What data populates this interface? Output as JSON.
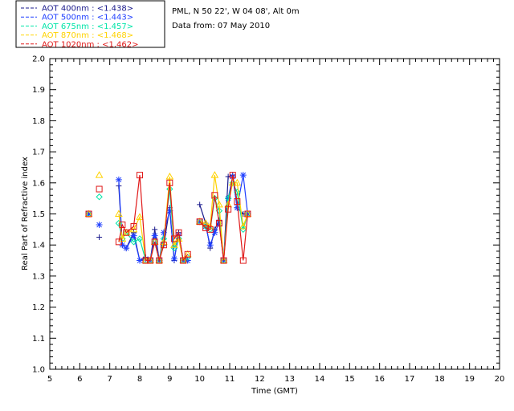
{
  "header": {
    "site": "PML, N 50 22', W 04 08', Alt 0m",
    "date": "Data from: 07 May 2010"
  },
  "chart_data": {
    "type": "line",
    "xlabel": "Time (GMT)",
    "ylabel": "Real Part of Refractive index",
    "xlim": [
      5,
      20
    ],
    "ylim": [
      1.0,
      2.0
    ],
    "xticks": [
      "5",
      "6",
      "7",
      "8",
      "9",
      "10",
      "11",
      "12",
      "13",
      "14",
      "15",
      "16",
      "17",
      "18",
      "19",
      "20"
    ],
    "yticks": [
      "1.0",
      "1.1",
      "1.2",
      "1.3",
      "1.4",
      "1.5",
      "1.6",
      "1.7",
      "1.8",
      "1.9",
      "2.0"
    ],
    "grid": false,
    "legend_position": "top-left-outside",
    "series": [
      {
        "name": "AOT  400nm : <1.438>",
        "color": "#1a1a8c",
        "marker": "plus",
        "groups": [
          [
            [
              6.3,
              1.5
            ]
          ],
          [
            [
              6.65,
              1.425
            ]
          ],
          [
            [
              7.3,
              1.59
            ],
            [
              7.42,
              1.4
            ],
            [
              7.55,
              1.39
            ],
            [
              7.8,
              1.44
            ],
            [
              8.0,
              1.35
            ],
            [
              8.2,
              1.36
            ],
            [
              8.35,
              1.35
            ],
            [
              8.5,
              1.45
            ],
            [
              8.65,
              1.35
            ],
            [
              8.8,
              1.4
            ],
            [
              9.0,
              1.52
            ],
            [
              9.15,
              1.35
            ],
            [
              9.3,
              1.44
            ],
            [
              9.45,
              1.35
            ],
            [
              9.6,
              1.35
            ]
          ],
          [
            [
              10.0,
              1.53
            ],
            [
              10.2,
              1.47
            ],
            [
              10.35,
              1.39
            ],
            [
              10.5,
              1.45
            ],
            [
              10.65,
              1.48
            ],
            [
              10.8,
              1.35
            ],
            [
              10.95,
              1.62
            ],
            [
              11.1,
              1.625
            ],
            [
              11.25,
              1.52
            ],
            [
              11.45,
              1.5
            ],
            [
              11.6,
              1.5
            ]
          ]
        ]
      },
      {
        "name": "AOT  500nm : <1.443>",
        "color": "#1f3fff",
        "marker": "asterisk",
        "groups": [
          [
            [
              6.3,
              1.5
            ]
          ],
          [
            [
              6.65,
              1.465
            ]
          ],
          [
            [
              7.3,
              1.61
            ],
            [
              7.42,
              1.4
            ],
            [
              7.55,
              1.39
            ],
            [
              7.8,
              1.43
            ],
            [
              8.0,
              1.35
            ],
            [
              8.2,
              1.355
            ],
            [
              8.35,
              1.35
            ],
            [
              8.5,
              1.43
            ],
            [
              8.65,
              1.35
            ],
            [
              8.8,
              1.44
            ],
            [
              9.0,
              1.51
            ],
            [
              9.15,
              1.355
            ],
            [
              9.3,
              1.43
            ],
            [
              9.45,
              1.35
            ],
            [
              9.6,
              1.35
            ]
          ],
          [
            [
              10.0,
              1.475
            ],
            [
              10.2,
              1.46
            ],
            [
              10.35,
              1.4
            ],
            [
              10.5,
              1.44
            ],
            [
              10.65,
              1.47
            ],
            [
              10.8,
              1.35
            ],
            [
              10.95,
              1.55
            ],
            [
              11.1,
              1.62
            ],
            [
              11.25,
              1.52
            ],
            [
              11.45,
              1.625
            ],
            [
              11.6,
              1.5
            ]
          ]
        ]
      },
      {
        "name": "AOT  675nm : <1.457>",
        "color": "#00e5a8",
        "marker": "diamond",
        "groups": [
          [
            [
              6.3,
              1.5
            ]
          ],
          [
            [
              6.65,
              1.555
            ]
          ],
          [
            [
              7.3,
              1.47
            ],
            [
              7.42,
              1.42
            ],
            [
              7.55,
              1.44
            ],
            [
              7.8,
              1.41
            ],
            [
              8.0,
              1.42
            ],
            [
              8.2,
              1.35
            ],
            [
              8.35,
              1.35
            ],
            [
              8.5,
              1.41
            ],
            [
              8.65,
              1.35
            ],
            [
              8.8,
              1.42
            ],
            [
              9.0,
              1.58
            ],
            [
              9.15,
              1.39
            ],
            [
              9.3,
              1.42
            ],
            [
              9.45,
              1.35
            ],
            [
              9.6,
              1.36
            ]
          ],
          [
            [
              10.0,
              1.475
            ],
            [
              10.2,
              1.46
            ],
            [
              10.35,
              1.45
            ],
            [
              10.5,
              1.55
            ],
            [
              10.65,
              1.51
            ],
            [
              10.8,
              1.35
            ],
            [
              10.95,
              1.55
            ],
            [
              11.1,
              1.6
            ],
            [
              11.25,
              1.57
            ],
            [
              11.45,
              1.45
            ],
            [
              11.6,
              1.5
            ]
          ]
        ]
      },
      {
        "name": "AOT  870nm : <1.468>",
        "color": "#ffd200",
        "marker": "triangle",
        "groups": [
          [
            [
              6.3,
              1.5
            ]
          ],
          [
            [
              6.65,
              1.625
            ]
          ],
          [
            [
              7.3,
              1.5
            ],
            [
              7.42,
              1.42
            ],
            [
              7.55,
              1.44
            ],
            [
              7.8,
              1.45
            ],
            [
              8.0,
              1.49
            ],
            [
              8.2,
              1.35
            ],
            [
              8.35,
              1.35
            ],
            [
              8.5,
              1.41
            ],
            [
              8.65,
              1.35
            ],
            [
              8.8,
              1.41
            ],
            [
              9.0,
              1.62
            ],
            [
              9.15,
              1.4
            ],
            [
              9.3,
              1.42
            ],
            [
              9.45,
              1.35
            ],
            [
              9.6,
              1.37
            ]
          ],
          [
            [
              10.0,
              1.475
            ],
            [
              10.2,
              1.47
            ],
            [
              10.35,
              1.46
            ],
            [
              10.5,
              1.625
            ],
            [
              10.65,
              1.53
            ],
            [
              10.8,
              1.35
            ],
            [
              10.95,
              1.53
            ],
            [
              11.1,
              1.6
            ],
            [
              11.25,
              1.6
            ],
            [
              11.45,
              1.46
            ],
            [
              11.6,
              1.5
            ]
          ]
        ]
      },
      {
        "name": "AOT 1020nm : <1.462>",
        "color": "#e01818",
        "marker": "square",
        "groups": [
          [
            [
              6.3,
              1.5
            ]
          ],
          [
            [
              6.65,
              1.58
            ]
          ],
          [
            [
              7.3,
              1.41
            ],
            [
              7.42,
              1.465
            ],
            [
              7.55,
              1.44
            ],
            [
              7.8,
              1.46
            ],
            [
              8.0,
              1.625
            ],
            [
              8.2,
              1.35
            ],
            [
              8.35,
              1.35
            ],
            [
              8.5,
              1.41
            ],
            [
              8.65,
              1.35
            ],
            [
              8.8,
              1.4
            ],
            [
              9.0,
              1.6
            ],
            [
              9.15,
              1.42
            ],
            [
              9.3,
              1.44
            ],
            [
              9.45,
              1.35
            ],
            [
              9.6,
              1.37
            ]
          ],
          [
            [
              10.0,
              1.475
            ],
            [
              10.2,
              1.455
            ],
            [
              10.35,
              1.45
            ],
            [
              10.5,
              1.56
            ],
            [
              10.65,
              1.47
            ],
            [
              10.8,
              1.35
            ],
            [
              10.95,
              1.515
            ],
            [
              11.1,
              1.625
            ],
            [
              11.25,
              1.54
            ],
            [
              11.45,
              1.35
            ],
            [
              11.6,
              1.5
            ]
          ]
        ]
      }
    ]
  }
}
